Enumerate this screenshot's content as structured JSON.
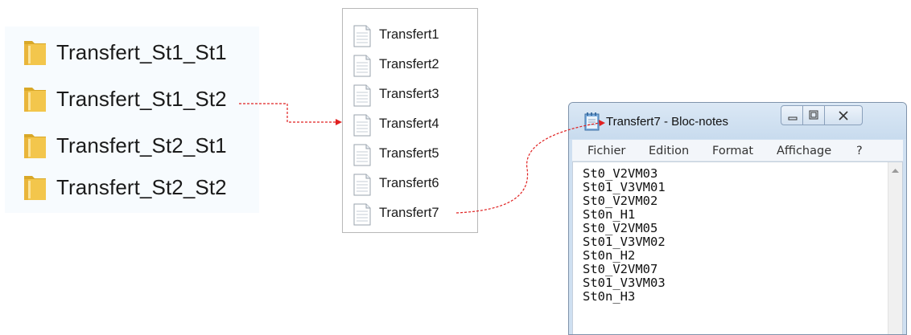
{
  "folders": [
    {
      "label": "Transfert_St1_St1",
      "icon": "folder-icon"
    },
    {
      "label": "Transfert_St1_St2",
      "icon": "folder-icon"
    },
    {
      "label": "Transfert_St2_St1",
      "icon": "folder-icon"
    },
    {
      "label": "Transfert_St2_St2",
      "icon": "folder-icon"
    }
  ],
  "files": [
    {
      "label": "Transfert1",
      "icon": "text-file-icon"
    },
    {
      "label": "Transfert2",
      "icon": "text-file-icon"
    },
    {
      "label": "Transfert3",
      "icon": "text-file-icon"
    },
    {
      "label": "Transfert4",
      "icon": "text-file-icon"
    },
    {
      "label": "Transfert5",
      "icon": "text-file-icon"
    },
    {
      "label": "Transfert6",
      "icon": "text-file-icon"
    },
    {
      "label": "Transfert7",
      "icon": "text-file-icon"
    }
  ],
  "notepad": {
    "title": "Transfert7 - Bloc-notes",
    "icon": "notepad-icon",
    "menu": [
      "Fichier",
      "Edition",
      "Format",
      "Affichage",
      "?"
    ],
    "lines": [
      "St0_V2VM03",
      "St01_V3VM01",
      "St0_V2VM02",
      "St0n_H1",
      "St0_V2VM05",
      "St01_V3VM02",
      "St0n_H2",
      "St0_V2VM07",
      "St01_V3VM03",
      "St0n_H3"
    ]
  },
  "colors": {
    "arrow": "#e02020",
    "folder_yellow": "#f3c64c",
    "window_frame": "#cfe0f1"
  }
}
